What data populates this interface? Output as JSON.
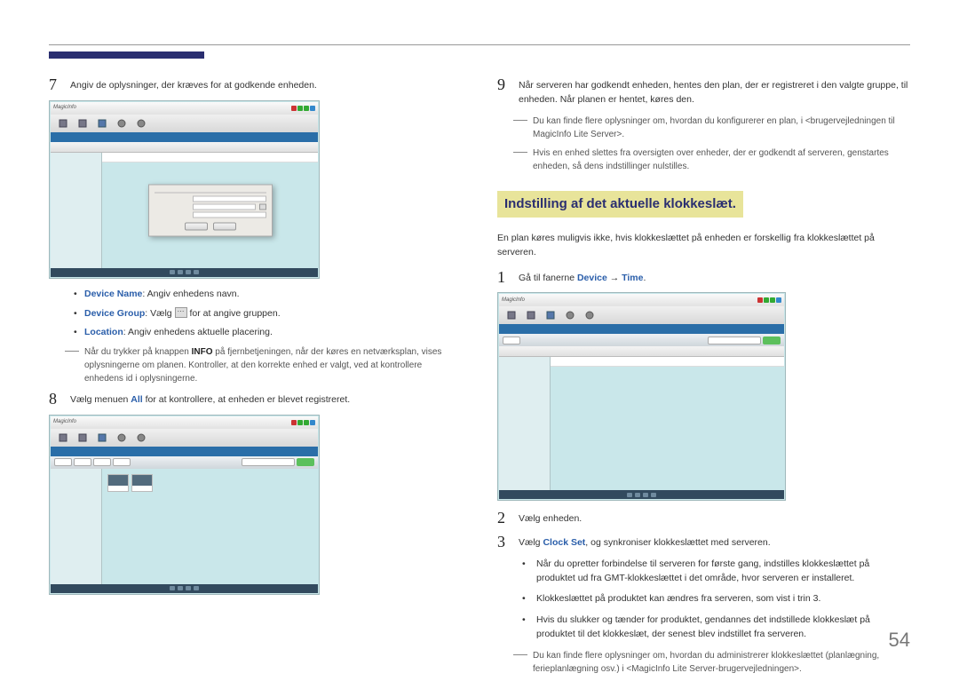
{
  "page_number": "54",
  "left": {
    "step7": {
      "num": "7",
      "text": "Angiv de oplysninger, der kræves for at godkende enheden."
    },
    "bullets": {
      "device_name_label": "Device Name",
      "device_name_text": ": Angiv enhedens navn.",
      "device_group_label": "Device Group",
      "device_group_prefix": ": Vælg ",
      "device_group_suffix": " for at angive gruppen.",
      "location_label": "Location",
      "location_text": ": Angiv enhedens aktuelle placering."
    },
    "note7": {
      "part1": "Når du trykker på knappen ",
      "info": "INFO",
      "part2": " på fjernbetjeningen, når der køres en netværksplan, vises oplysningerne om planen. Kontroller, at den korrekte enhed er valgt, ved at kontrollere enhedens id i oplysningerne."
    },
    "step8": {
      "num": "8",
      "prefix": "Vælg menuen ",
      "all": "All",
      "suffix": " for at kontrollere, at enheden er blevet registreret."
    }
  },
  "right": {
    "step9": {
      "num": "9",
      "text": "Når serveren har godkendt enheden, hentes den plan, der er registreret i den valgte gruppe, til enheden. Når planen er hentet, køres den."
    },
    "note9a": "Du kan finde flere oplysninger om, hvordan du konfigurerer en plan, i <brugervejledningen til MagicInfo Lite Server>.",
    "note9b": "Hvis en enhed slettes fra oversigten over enheder, der er godkendt af serveren, genstartes enheden, så dens indstillinger nulstilles.",
    "section_title": "Indstilling af det aktuelle klokkeslæt.",
    "section_intro": "En plan køres muligvis ikke, hvis klokkeslættet på enheden er forskellig fra klokkeslættet på serveren.",
    "step1": {
      "num": "1",
      "prefix": "Gå til fanerne ",
      "device": "Device",
      "arrow": " → ",
      "time": "Time",
      "suffix": "."
    },
    "step2": {
      "num": "2",
      "text": "Vælg enheden."
    },
    "step3": {
      "num": "3",
      "prefix": "Vælg ",
      "clockset": "Clock Set",
      "suffix": ", og synkroniser klokkeslættet med serveren."
    },
    "sub_bullets": {
      "b1": "Når du opretter forbindelse til serveren for første gang, indstilles klokkeslættet på produktet ud fra GMT-klokkeslættet i det område, hvor serveren er installeret.",
      "b2": "Klokkeslættet på produktet kan ændres fra serveren, som vist i trin 3.",
      "b3": "Hvis du slukker og tænder for produktet, gendannes det indstillede klokkeslæt på produktet til det klokkeslæt, der senest blev indstillet fra serveren."
    },
    "note_bottom": "Du kan finde flere oplysninger om, hvordan du administrerer klokkeslættet (planlægning, ferieplanlægning osv.) i <MagicInfo Lite Server-brugervejledningen>."
  },
  "screenshots": {
    "logo": "MagicInfo"
  }
}
